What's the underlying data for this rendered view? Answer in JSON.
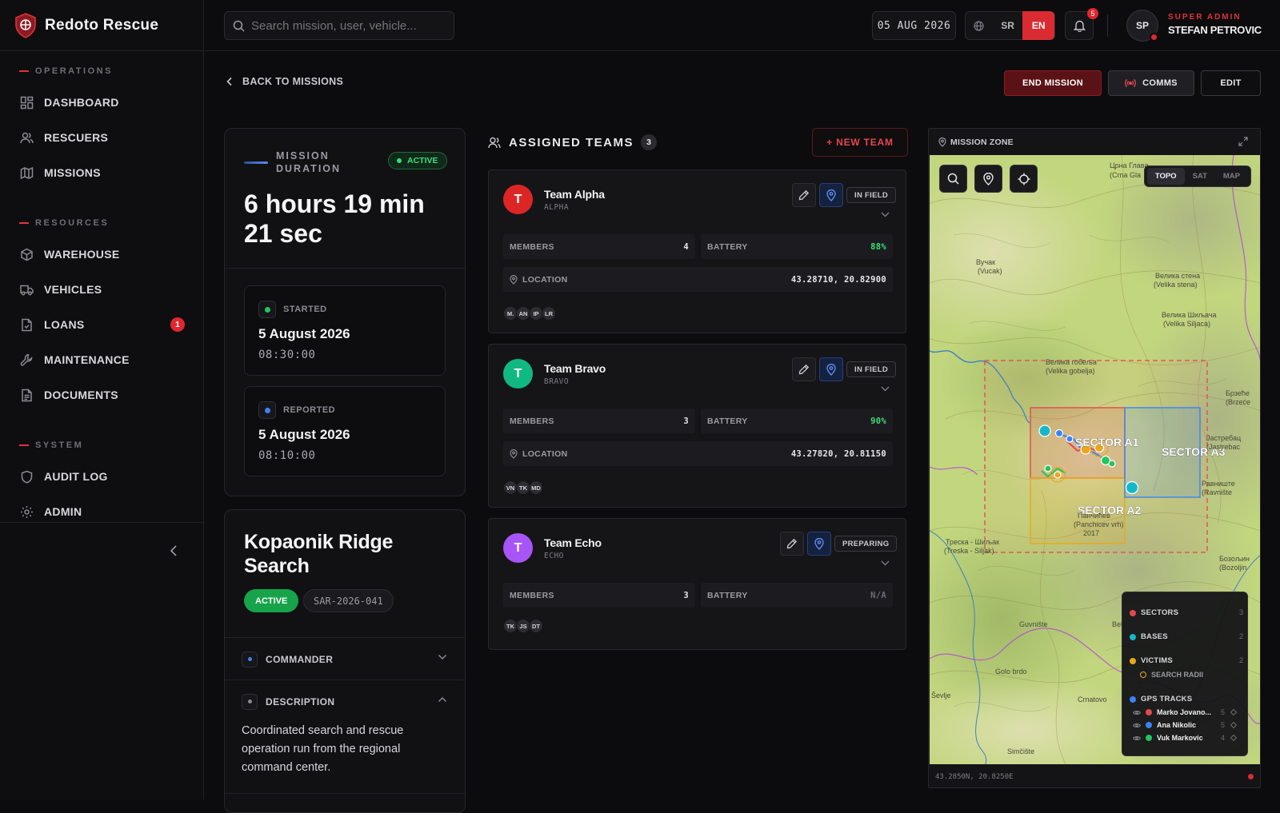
{
  "app": {
    "name": "Redoto Rescue"
  },
  "sidebar": {
    "sections": [
      {
        "label": "OPERATIONS",
        "items": [
          {
            "label": "DASHBOARD",
            "icon": "dashboard-icon"
          },
          {
            "label": "RESCUERS",
            "icon": "users-icon"
          },
          {
            "label": "MISSIONS",
            "icon": "map-icon"
          }
        ]
      },
      {
        "label": "RESOURCES",
        "items": [
          {
            "label": "WAREHOUSE",
            "icon": "box-icon"
          },
          {
            "label": "VEHICLES",
            "icon": "truck-icon"
          },
          {
            "label": "LOANS",
            "icon": "file-icon",
            "badge": "1"
          },
          {
            "label": "MAINTENANCE",
            "icon": "wrench-icon"
          },
          {
            "label": "DOCUMENTS",
            "icon": "document-icon"
          }
        ]
      },
      {
        "label": "SYSTEM",
        "items": [
          {
            "label": "AUDIT LOG",
            "icon": "shield-icon"
          },
          {
            "label": "ADMIN",
            "icon": "gear-icon"
          }
        ]
      }
    ]
  },
  "topbar": {
    "search_placeholder": "Search mission, user, vehicle...",
    "date": "05 AUG 2026",
    "lang_sr": "SR",
    "lang_en": "EN",
    "notifications": "5",
    "avatar_initials": "SP",
    "user_role": "SUPER ADMIN",
    "user_name": "STEFAN PETROVIC"
  },
  "actions": {
    "back": "BACK TO MISSIONS",
    "end": "END MISSION",
    "comms": "COMMS",
    "edit": "EDIT"
  },
  "duration": {
    "label": "MISSION DURATION",
    "status": "ACTIVE",
    "value": "6 hours 19 min 21 sec",
    "started_label": "STARTED",
    "started_date": "5 August 2026",
    "started_time": "08:30:00",
    "reported_label": "REPORTED",
    "reported_date": "5 August 2026",
    "reported_time": "08:10:00"
  },
  "mission": {
    "title": "Kopaonik Ridge Search",
    "status": "ACTIVE",
    "code": "SAR-2026-041",
    "commander_label": "COMMANDER",
    "description_label": "DESCRIPTION",
    "description": "Coordinated search and rescue operation run from the regional command center."
  },
  "teams": {
    "title": "ASSIGNED TEAMS",
    "count": "3",
    "new_label": "+ NEW TEAM",
    "members_label": "MEMBERS",
    "battery_label": "BATTERY",
    "location_label": "LOCATION",
    "list": [
      {
        "initial": "T",
        "name": "Team Alpha",
        "code": "ALPHA",
        "status": "IN FIELD",
        "color": "#dc2626",
        "members": "4",
        "battery": "88%",
        "location": "43.28710, 20.82900",
        "initials": [
          "M.",
          "AN",
          "IP",
          "LR"
        ]
      },
      {
        "initial": "T",
        "name": "Team Bravo",
        "code": "BRAVO",
        "status": "IN FIELD",
        "color": "#10b981",
        "members": "3",
        "battery": "90%",
        "location": "43.27820, 20.81150",
        "initials": [
          "VN",
          "TK",
          "MD"
        ]
      },
      {
        "initial": "T",
        "name": "Team Echo",
        "code": "ECHO",
        "status": "PREPARING",
        "color": "#a855f7",
        "members": "3",
        "battery": "N/A",
        "initials": [
          "TK",
          "JS",
          "DT"
        ]
      }
    ]
  },
  "map": {
    "title": "MISSION ZONE",
    "modes": [
      "TOPO",
      "SAT",
      "MAP"
    ],
    "active_mode": "TOPO",
    "coords": "43.2850N, 20.8250E",
    "sectors": [
      "SECTOR A1",
      "SECTOR A2",
      "SECTOR A3"
    ],
    "place_labels": {
      "crna_glava": "Црна Глава",
      "crna_glava_lat": "(Crna Gla",
      "vucak": "Вучак",
      "vucak_lat": "(Vucak)",
      "velika_stena": "Велика стена",
      "velika_stena_lat": "(Velika stena)",
      "velika_siljaca": "Велика Шиљача",
      "velika_siljaca_lat": "(Velika Siljaca)",
      "velika_gobelja": "Велика гобеља",
      "velika_gobelja_lat": "(Velika gobelja)",
      "brzece": "Брзеће",
      "brzece_lat": "(Brzeće",
      "jastrebac": "Јастребац",
      "jastrebac_lat": "(Jastrebac",
      "ravniste": "Равниште",
      "ravniste_lat": "(Ravnište",
      "panchicev_vrh": "Панчићев",
      "panchicev_vrh_lat": "(Panchicev vrh)",
      "elevation": "2017",
      "treska_siljak": "Треска - Шиљак",
      "treska_siljak_lat": "(Treska - Siljak)",
      "bozoljin": "Бозољин",
      "bozoljin_lat": "(Bozoljin",
      "guvniste": "Guvnište",
      "golo_brdo": "Golo brdo",
      "crnatovo": "Crnatovo",
      "sevlje": "Ševlje",
      "simciste": "Simčište",
      "bel": "Bel"
    },
    "legend": {
      "sectors": "SECTORS",
      "sectors_count": "3",
      "bases": "BASES",
      "bases_count": "2",
      "victims": "VICTIMS",
      "victims_count": "2",
      "search_radii": "SEARCH RADII",
      "gps_tracks": "GPS TRACKS",
      "tracks": [
        {
          "name": "Marko Jovano...",
          "count": "5",
          "color": "#e5484d"
        },
        {
          "name": "Ana Nikolic",
          "count": "5",
          "color": "#3b82f6"
        },
        {
          "name": "Vuk Markovic",
          "count": "4",
          "color": "#22c55e"
        }
      ]
    }
  }
}
